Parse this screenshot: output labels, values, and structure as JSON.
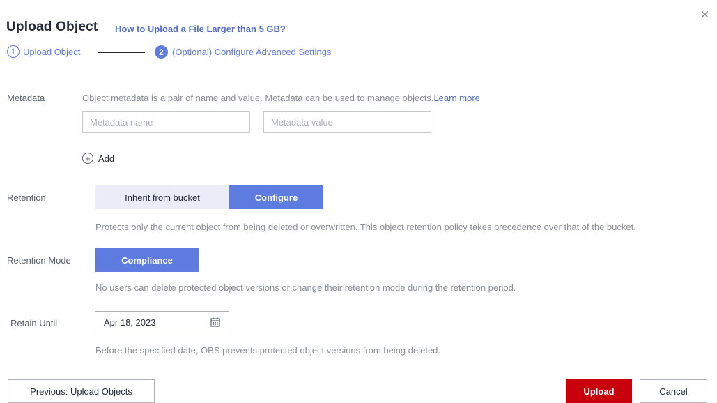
{
  "dialog": {
    "close_glyph": "×",
    "title": "Upload Object",
    "title_link": "How to Upload a File Larger than 5 GB?"
  },
  "steps": [
    {
      "number": "1",
      "label": "Upload Object",
      "state": "done"
    },
    {
      "number": "2",
      "label": "(Optional) Configure Advanced Settings",
      "state": "active"
    }
  ],
  "metadata": {
    "label": "Metadata",
    "description": "Object metadata is a pair of name and value. Metadata can be used to manage objects.",
    "learn_more": "Learn more",
    "name_placeholder": "Metadata name",
    "value_placeholder": "Metadata value",
    "add_label": "Add"
  },
  "retention": {
    "label": "Retention",
    "options": [
      "Inherit from bucket",
      "Configure"
    ],
    "selected": "Configure",
    "description": "Protects only the current object from being deleted or overwritten. This object retention policy takes precedence over that of the bucket."
  },
  "retention_mode": {
    "label": "Retention Mode",
    "option": "Compliance",
    "description": "No users can delete protected object versions or change their retention mode during the retention period."
  },
  "retain_until": {
    "label": "Retain Until",
    "value": "Apr 18, 2023",
    "description": "Before the specified date, OBS prevents protected object versions from being deleted."
  },
  "footer": {
    "previous_label": "Previous: Upload Objects",
    "upload_label": "Upload",
    "cancel_label": "Cancel"
  },
  "colors": {
    "accent": "#5e7ce0",
    "primary_button": "#c7000b",
    "segment_inactive": "#eaedf7"
  },
  "icons": {
    "close": "close-icon",
    "add": "add-circle-icon",
    "calendar": "calendar-icon"
  }
}
